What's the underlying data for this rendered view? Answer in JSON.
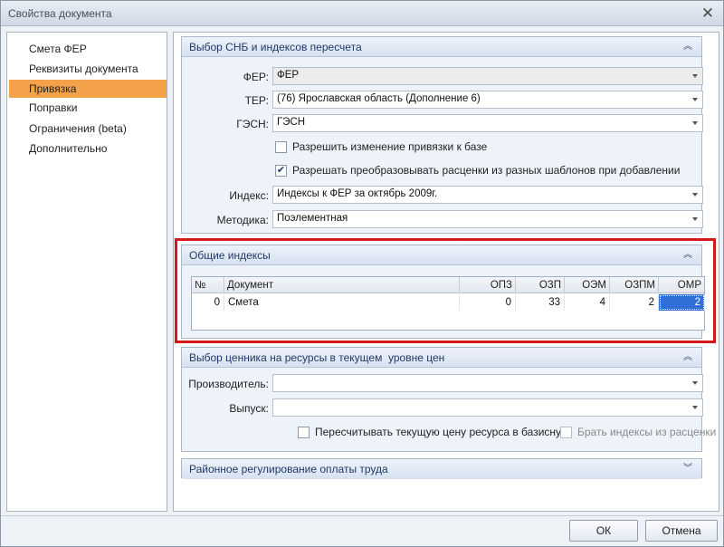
{
  "window": {
    "title": "Свойства документа",
    "close_glyph": "✕"
  },
  "sidebar": {
    "items": [
      {
        "label": "Смета ФЕР",
        "active": false
      },
      {
        "label": "Реквизиты документа",
        "active": false
      },
      {
        "label": "Привязка",
        "active": true
      },
      {
        "label": "Поправки",
        "active": false
      },
      {
        "label": "Ограничения (beta)",
        "active": false
      },
      {
        "label": "Дополнительно",
        "active": false
      }
    ]
  },
  "snb_group": {
    "title": "Выбор СНБ и индексов пересчета",
    "collapse_icon": "chevron-up-double-icon",
    "fer": {
      "label": "ФЕР:",
      "value": "ФЕР"
    },
    "ter": {
      "label": "ТЕР:",
      "value": "(76) Ярославская область (Дополнение 6)"
    },
    "gesn": {
      "label": "ГЭСН:",
      "value": "ГЭСН"
    },
    "allow_change": {
      "label": "Разрешить изменение привязки к базе",
      "checked": false
    },
    "allow_convert": {
      "label": "Разрешать преобразовывать расценки из разных шаблонов при добавлении",
      "checked": true
    },
    "index": {
      "label": "Индекс:",
      "value": "Индексы к ФЕР за октябрь 2009г."
    },
    "method": {
      "label": "Методика:",
      "value": "Поэлементная"
    }
  },
  "common_indexes": {
    "title": "Общие индексы",
    "collapse_icon": "chevron-up-double-icon",
    "columns": [
      "№",
      "Документ",
      "ОПЗ",
      "ОЗП",
      "ОЭМ",
      "ОЗПМ",
      "ОМР"
    ],
    "rows": [
      [
        "0",
        "Смета",
        "0",
        "33",
        "4",
        "2",
        "2"
      ]
    ]
  },
  "price_group": {
    "title": "Выбор ценника на ресурсы в текущем  уровне цен",
    "collapse_icon": "chevron-up-double-icon",
    "producer": {
      "label": "Производитель:",
      "value": ""
    },
    "release": {
      "label": "Выпуск:",
      "value": ""
    },
    "recalc": {
      "label": "Пересчитывать текущую цену ресурса в базисную",
      "checked": false
    },
    "take_indexes": {
      "label": "Брать индексы из расценки",
      "checked": false,
      "disabled": true
    }
  },
  "regional_group": {
    "title": "Районное регулирование оплаты труда",
    "collapse_icon": "chevron-down-double-icon"
  },
  "buttons": {
    "ok": "ОК",
    "cancel": "Отмена"
  },
  "colors": {
    "active_nav": "#f4a24a",
    "highlight_border": "#d21a1a",
    "selected_cell": "#2f6fd6"
  }
}
